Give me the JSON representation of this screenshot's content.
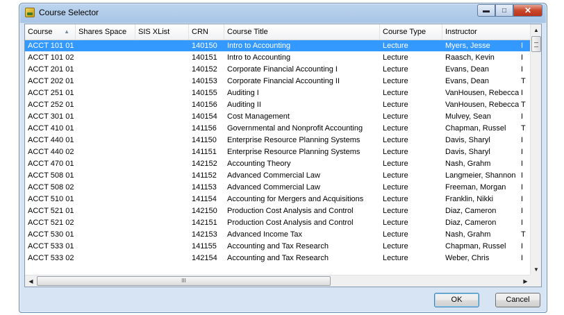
{
  "window": {
    "title": "Course Selector"
  },
  "controls": {
    "minimize": "▬",
    "maximize": "□",
    "close": "✕"
  },
  "columns": [
    {
      "key": "course",
      "label": "Course",
      "sorted": "ascending"
    },
    {
      "key": "shares_space",
      "label": "Shares Space"
    },
    {
      "key": "sis_xlist",
      "label": "SIS XList"
    },
    {
      "key": "crn",
      "label": "CRN"
    },
    {
      "key": "title",
      "label": "Course Title"
    },
    {
      "key": "type",
      "label": "Course Type"
    },
    {
      "key": "instructor",
      "label": "Instructor"
    }
  ],
  "rows": [
    {
      "course": "ACCT 101 01",
      "crn": "140150",
      "title": "Intro to Accounting",
      "type": "Lecture",
      "instructor": "Myers, Jesse",
      "extra": "I",
      "selected": true
    },
    {
      "course": "ACCT 101 02",
      "crn": "140151",
      "title": "Intro to Accounting",
      "type": "Lecture",
      "instructor": "Raasch, Kevin",
      "extra": "I"
    },
    {
      "course": "ACCT 201 01",
      "crn": "140152",
      "title": "Corporate Financial Accounting I",
      "type": "Lecture",
      "instructor": "Evans, Dean",
      "extra": "I"
    },
    {
      "course": "ACCT 202 01",
      "crn": "140153",
      "title": "Corporate Financial Accounting II",
      "type": "Lecture",
      "instructor": "Evans, Dean",
      "extra": "T"
    },
    {
      "course": "ACCT 251 01",
      "crn": "140155",
      "title": "Auditing I",
      "type": "Lecture",
      "instructor": "VanHousen, Rebecca",
      "extra": "I"
    },
    {
      "course": "ACCT 252 01",
      "crn": "140156",
      "title": "Auditing II",
      "type": "Lecture",
      "instructor": "VanHousen, Rebecca",
      "extra": "T"
    },
    {
      "course": "ACCT 301 01",
      "crn": "140154",
      "title": "Cost Management",
      "type": "Lecture",
      "instructor": "Mulvey, Sean",
      "extra": "I"
    },
    {
      "course": "ACCT 410 01",
      "crn": "141156",
      "title": "Governmental and Nonprofit Accounting",
      "type": "Lecture",
      "instructor": "Chapman, Russel",
      "extra": "T"
    },
    {
      "course": "ACCT 440 01",
      "crn": "141150",
      "title": "Enterprise Resource Planning Systems",
      "type": "Lecture",
      "instructor": "Davis, Sharyl",
      "extra": "I"
    },
    {
      "course": "ACCT 440 02",
      "crn": "141151",
      "title": "Enterprise Resource Planning Systems",
      "type": "Lecture",
      "instructor": "Davis, Sharyl",
      "extra": "I"
    },
    {
      "course": "ACCT 470 01",
      "crn": "142152",
      "title": "Accounting Theory",
      "type": "Lecture",
      "instructor": "Nash, Grahm",
      "extra": "I"
    },
    {
      "course": "ACCT 508 01",
      "crn": "141152",
      "title": "Advanced Commercial Law",
      "type": "Lecture",
      "instructor": "Langmeier, Shannon",
      "extra": "I"
    },
    {
      "course": "ACCT 508 02",
      "crn": "141153",
      "title": "Advanced Commercial Law",
      "type": "Lecture",
      "instructor": "Freeman, Morgan",
      "extra": "I"
    },
    {
      "course": "ACCT 510 01",
      "crn": "141154",
      "title": "Accounting for Mergers and Acquisitions",
      "type": "Lecture",
      "instructor": "Franklin, Nikki",
      "extra": "I"
    },
    {
      "course": "ACCT 521 01",
      "crn": "142150",
      "title": "Production Cost Analysis and Control",
      "type": "Lecture",
      "instructor": "Diaz, Cameron",
      "extra": "I"
    },
    {
      "course": "ACCT 521 02",
      "crn": "142151",
      "title": "Production Cost Analysis and Control",
      "type": "Lecture",
      "instructor": "Diaz, Cameron",
      "extra": "I"
    },
    {
      "course": "ACCT 530 01",
      "crn": "142153",
      "title": "Advanced Income Tax",
      "type": "Lecture",
      "instructor": "Nash, Grahm",
      "extra": "T"
    },
    {
      "course": "ACCT 533 01",
      "crn": "141155",
      "title": "Accounting and Tax Research",
      "type": "Lecture",
      "instructor": "Chapman, Russel",
      "extra": "I"
    },
    {
      "course": "ACCT 533 02",
      "crn": "142154",
      "title": "Accounting and Tax Research",
      "type": "Lecture",
      "instructor": "Weber, Chris",
      "extra": "I"
    }
  ],
  "scrollbars": {
    "up": "▲",
    "down": "▼",
    "left": "◀",
    "right": "▶",
    "grip": "III"
  },
  "buttons": {
    "ok": "OK",
    "cancel": "Cancel"
  },
  "colors": {
    "selection": "#3399ff",
    "title_bar": "#bcd4ee",
    "close_button": "#c9472a"
  }
}
